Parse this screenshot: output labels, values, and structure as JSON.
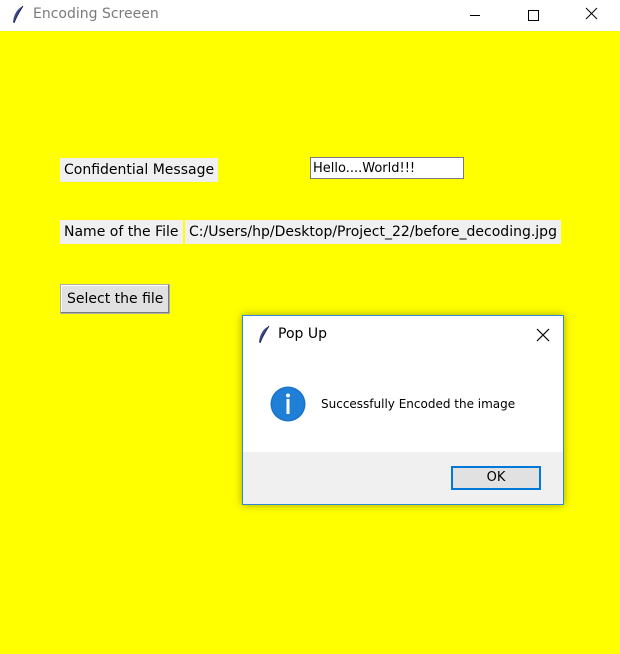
{
  "window": {
    "title": "Encoding Screeen",
    "background": "#ffff00"
  },
  "form": {
    "message_label": "Confidential Message",
    "message_value": "Hello....World!!!",
    "filename_label": "Name of the File",
    "filename_value": "C:/Users/hp/Desktop/Project_22/before_decoding.jpg",
    "select_button": "Select the file"
  },
  "popup": {
    "title": "Pop Up",
    "message": "Successfully Encoded the image",
    "ok_label": "OK",
    "icon": "info-icon",
    "accent": "#0078d7"
  }
}
